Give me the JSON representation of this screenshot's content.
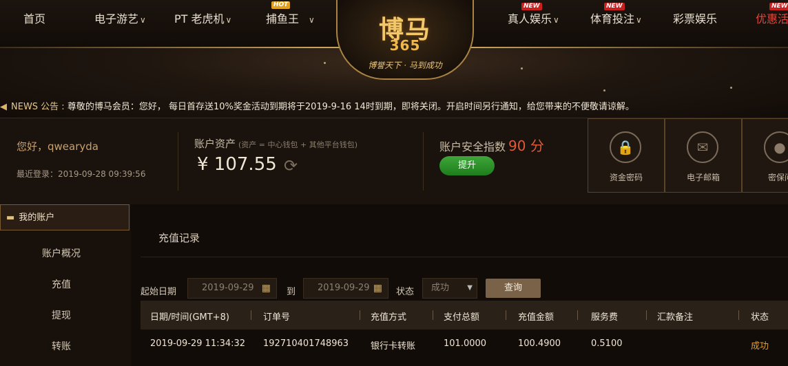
{
  "nav": {
    "items": [
      {
        "label": "首页",
        "chevron": false
      },
      {
        "label": "电子游艺",
        "chevron": true
      },
      {
        "label": "PT 老虎机",
        "chevron": true
      },
      {
        "label": "捕鱼王",
        "chevron": true,
        "badge": "HOT"
      },
      {
        "label": "真人娱乐",
        "chevron": true,
        "badge": "NEW"
      },
      {
        "label": "体育投注",
        "chevron": true,
        "badge": "NEW"
      },
      {
        "label": "彩票娱乐",
        "chevron": false
      },
      {
        "label": "优惠活",
        "chevron": false,
        "badge": "NEW"
      }
    ]
  },
  "logo": {
    "main": "博马",
    "num": "365",
    "slogan": "博誉天下 · 马到成功"
  },
  "news": {
    "label": "NEWS 公告 :",
    "text": "尊敬的博马会员：您好， 每日首存送10%奖金活动到期将于2019-9-16 14时到期，即将关闭。开启时间另行通知，给您带来的不便敬请谅解。"
  },
  "account": {
    "greeting": "您好，qwearyda",
    "last_login": "最近登录：2019-09-28 09:39:56",
    "assets_title": "账户资产",
    "assets_note": "(资产 = 中心钱包 + 其他平台钱包)",
    "amount": "¥ 107.55",
    "security_title": "账户安全指数",
    "security_score": "90 分",
    "upgrade_label": "提升",
    "tiles": [
      {
        "label": "资金密码",
        "icon": "lock-icon"
      },
      {
        "label": "电子邮箱",
        "icon": "mail-icon"
      },
      {
        "label": "密保问",
        "icon": "bulb-icon"
      }
    ]
  },
  "sidebar": {
    "header": "我的账户",
    "items": [
      "账户概况",
      "充值",
      "提现",
      "转账"
    ]
  },
  "main": {
    "title": "充值记录",
    "filters": {
      "start_label": "起始日期",
      "start_value": "2019-09-29",
      "to_label": "到",
      "end_value": "2019-09-29",
      "status_label": "状态",
      "status_value": "成功",
      "query_label": "查询"
    },
    "columns": [
      "日期/时间(GMT+8)",
      "订单号",
      "充值方式",
      "支付总额",
      "充值金额",
      "服务费",
      "汇款备注",
      "状态"
    ],
    "rows": [
      [
        "2019-09-29 11:34:32",
        "192710401748963",
        "银行卡转账",
        "101.0000",
        "100.4900",
        "0.5100",
        "",
        "成功"
      ]
    ]
  }
}
